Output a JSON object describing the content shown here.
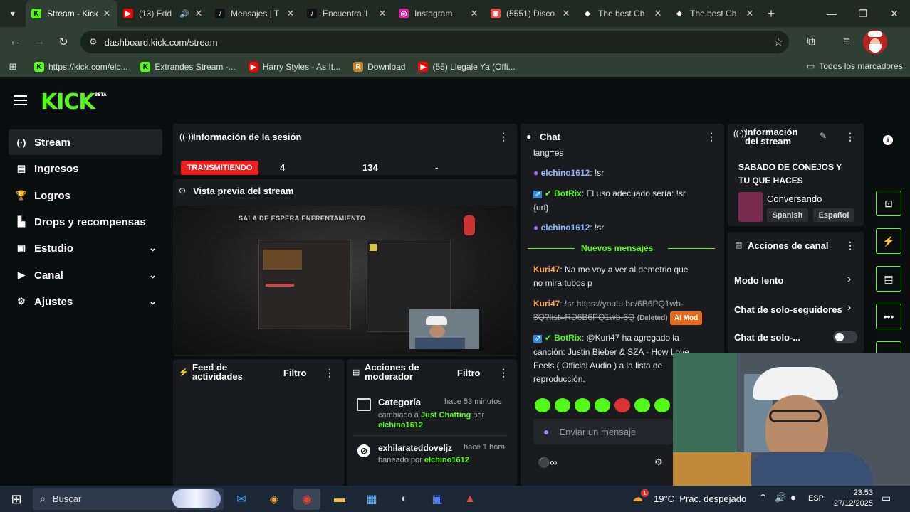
{
  "browser": {
    "tabs": [
      {
        "title": "Stream - Kick",
        "icon": "kick-icon",
        "icon_glyph": "K",
        "active": true
      },
      {
        "title": "(13) Edd",
        "icon": "youtube-icon",
        "icon_glyph": "▶",
        "audio": true
      },
      {
        "title": "Mensajes | T",
        "icon": "tiktok-icon",
        "icon_glyph": "♪"
      },
      {
        "title": "Encuentra 'l",
        "icon": "tiktok-icon",
        "icon_glyph": "♪"
      },
      {
        "title": "Instagram",
        "icon": "instagram-icon",
        "icon_glyph": "◎"
      },
      {
        "title": "(5551) Disco",
        "icon": "discord-icon",
        "icon_glyph": "◉"
      },
      {
        "title": "The best Ch",
        "icon": "chatbot-icon",
        "icon_glyph": "◆"
      },
      {
        "title": "The best Ch",
        "icon": "chatbot-icon",
        "icon_glyph": "◆"
      }
    ],
    "url": "dashboard.kick.com/stream",
    "bookmarks": [
      {
        "label": "https://kick.com/elc...",
        "glyph": "K",
        "color": "#53fc18"
      },
      {
        "label": "Extrandes Stream -...",
        "glyph": "K",
        "color": "#53fc18"
      },
      {
        "label": "Harry Styles - As It...",
        "glyph": "▶",
        "color": "#ff0000"
      },
      {
        "label": "Download",
        "glyph": "R",
        "color": "#c8852a"
      },
      {
        "label": "(55) Llegale Ya (Offi...",
        "glyph": "▶",
        "color": "#ff0000"
      }
    ],
    "all_bookmarks": "Todos los marcadores"
  },
  "sidebar": {
    "logo": "KICK",
    "logo_tag": "BETA",
    "items": [
      {
        "label": "Stream",
        "icon": "signal-icon",
        "glyph": "(·)",
        "active": true
      },
      {
        "label": "Ingresos",
        "icon": "revenue-icon",
        "glyph": "▤"
      },
      {
        "label": "Logros",
        "icon": "trophy-icon",
        "glyph": "🏆"
      },
      {
        "label": "Drops y recompensas",
        "icon": "drops-icon",
        "glyph": "▙"
      },
      {
        "label": "Estudio",
        "icon": "studio-icon",
        "glyph": "▣",
        "expandable": true
      },
      {
        "label": "Canal",
        "icon": "channel-icon",
        "glyph": "▶",
        "expandable": true
      },
      {
        "label": "Ajustes",
        "icon": "gear-icon",
        "glyph": "⚙",
        "expandable": true
      }
    ]
  },
  "session": {
    "title": "Información de la sesión",
    "status": "TRANSMITIENDO",
    "stats": [
      "4",
      "134",
      "-"
    ]
  },
  "preview": {
    "title": "Vista previa del stream",
    "overlay_text": "SALA DE ESPERA ENFRENTAMIENTO"
  },
  "activity_feed": {
    "title_line1": "Feed de",
    "title_line2": "actividades",
    "filter": "Filtro"
  },
  "mod_actions": {
    "title_line1": "Acciones de",
    "title_line2": "moderador",
    "filter": "Filtro",
    "entries": [
      {
        "title": "Categoría",
        "time": "hace 53 minutos",
        "prefix": "cambiado a",
        "target": "Just Chatting",
        "by": "por",
        "user": "elchino1612"
      },
      {
        "title": "exhilarateddoveljz",
        "time": "hace 1 hora",
        "prefix": "baneado por",
        "user": "elchino1612"
      }
    ]
  },
  "chat": {
    "title": "Chat",
    "top_fragment": "lang=es",
    "messages": [
      {
        "user": "elchino1612",
        "text": ": !sr"
      },
      {
        "user": "BotRix",
        "text": ": El uso adecuado sería: !sr",
        "text2": "{url}"
      },
      {
        "user": "elchino1612",
        "text": ": !sr"
      }
    ],
    "new_messages": "Nuevos mensajes",
    "messages_after": [
      {
        "user": "Kuri47",
        "text": ": Na me voy a ver al demetrio que",
        "text2": "no mira tubos p"
      },
      {
        "user": "Kuri47",
        "cmd": ": !sr",
        "link1": "https://youtu.be/6B6PQ1wb-",
        "link2": "3Q?list=RD6B6PQ1wb-3Q",
        "deleted": "(Deleted)",
        "badge": "AI Mod"
      },
      {
        "user": "BotRix",
        "text": ": @Kuri47 ha agregado la",
        "text2": "canción: Justin Bieber & SZA - How Love",
        "text3": "Feels ( Official Audio ) a la lista de",
        "text4": "reproducción."
      }
    ],
    "input_placeholder": "Enviar un mensaje"
  },
  "stream_info": {
    "title_line1": "Información",
    "title_line2": "del stream",
    "stream_title": "SABADO DE CONEJOS Y TU QUE HACES",
    "category": "Conversando",
    "tags": [
      "Spanish",
      "Español"
    ]
  },
  "channel_actions": {
    "title": "Acciones de canal",
    "items": [
      {
        "label": "Modo lento"
      },
      {
        "label": "Chat de solo-seguidores"
      },
      {
        "label": "Chat de solo-..."
      }
    ]
  },
  "taskbar": {
    "search": "Buscar",
    "weather": "19°C  Prac. despejado",
    "lang": "ESP",
    "time": "23:53",
    "date": "27/12/2025",
    "weather_badge": "1"
  },
  "colors": {
    "kick_green": "#53fc18",
    "live_red": "#ea1f1f",
    "panel_bg": "#191b1f",
    "page_bg": "#0b0e0f"
  }
}
